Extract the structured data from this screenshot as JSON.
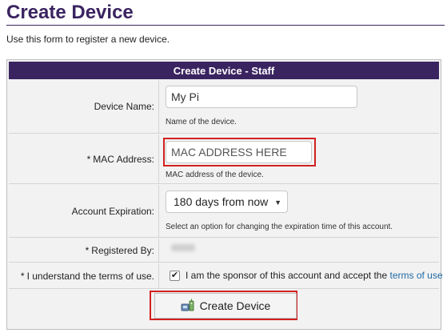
{
  "page": {
    "title": "Create Device",
    "intro": "Use this form to register a new device."
  },
  "form": {
    "header": "Create Device - Staff",
    "device_name": {
      "label": "Device Name:",
      "value": "My Pi",
      "hint": "Name of the device."
    },
    "mac_address": {
      "required_mark": "*",
      "label": "MAC Address:",
      "placeholder": "MAC ADDRESS HERE",
      "hint": "MAC address of the device."
    },
    "account_expiration": {
      "label": "Account Expiration:",
      "selected": "180 days from now",
      "hint": "Select an option for changing the expiration time of this account."
    },
    "registered_by": {
      "required_mark": "*",
      "label": "Registered By:"
    },
    "terms": {
      "required_mark": "*",
      "label": "I understand the terms of use.",
      "checked": true,
      "text": "I am the sponsor of this account and accept the ",
      "link_text": "terms of use"
    },
    "submit": {
      "label": "Create Device",
      "icon": "device-network-icon"
    }
  },
  "colors": {
    "brand": "#3a2460",
    "highlight": "#d22020",
    "link": "#1f6aa5"
  }
}
